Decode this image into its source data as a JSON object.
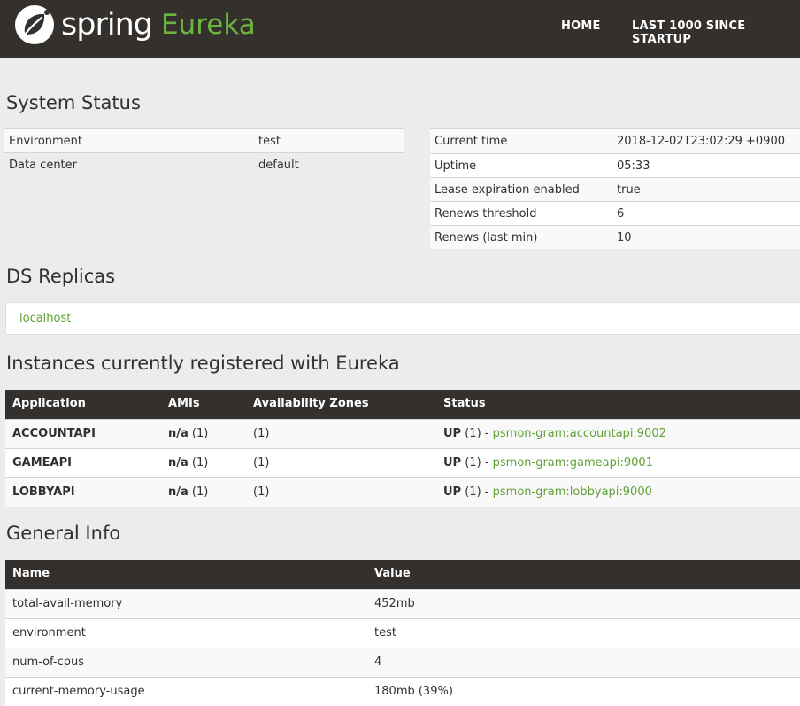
{
  "header": {
    "logo_spring": "spring",
    "logo_eureka": "Eureka",
    "nav": [
      {
        "label": "HOME"
      },
      {
        "label": "LAST 1000 SINCE STARTUP"
      }
    ]
  },
  "system_status": {
    "title": "System Status",
    "left": [
      {
        "key": "Environment",
        "value": "test"
      },
      {
        "key": "Data center",
        "value": "default"
      }
    ],
    "right": [
      {
        "key": "Current time",
        "value": "2018-12-02T23:02:29 +0900"
      },
      {
        "key": "Uptime",
        "value": "05:33"
      },
      {
        "key": "Lease expiration enabled",
        "value": "true"
      },
      {
        "key": "Renews threshold",
        "value": "6"
      },
      {
        "key": "Renews (last min)",
        "value": "10"
      }
    ]
  },
  "ds_replicas": {
    "title": "DS Replicas",
    "items": [
      "localhost"
    ]
  },
  "instances": {
    "title": "Instances currently registered with Eureka",
    "columns": [
      "Application",
      "AMIs",
      "Availability Zones",
      "Status"
    ],
    "rows": [
      {
        "app": "ACCOUNTAPI",
        "ami_na": "n/a",
        "ami_count": "(1)",
        "zones": "(1)",
        "status": "UP",
        "status_count": "(1) -",
        "link": "psmon-gram:accountapi:9002"
      },
      {
        "app": "GAMEAPI",
        "ami_na": "n/a",
        "ami_count": "(1)",
        "zones": "(1)",
        "status": "UP",
        "status_count": "(1) -",
        "link": "psmon-gram:gameapi:9001"
      },
      {
        "app": "LOBBYAPI",
        "ami_na": "n/a",
        "ami_count": "(1)",
        "zones": "(1)",
        "status": "UP",
        "status_count": "(1) -",
        "link": "psmon-gram:lobbyapi:9000"
      }
    ]
  },
  "general_info": {
    "title": "General Info",
    "columns": [
      "Name",
      "Value"
    ],
    "rows": [
      {
        "name": "total-avail-memory",
        "value": "452mb"
      },
      {
        "name": "environment",
        "value": "test"
      },
      {
        "name": "num-of-cpus",
        "value": "4"
      },
      {
        "name": "current-memory-usage",
        "value": "180mb (39%)"
      }
    ]
  },
  "colors": {
    "header_bg": "#34302d",
    "accent_green": "#6db33f",
    "link_green": "#5fa134"
  },
  "icons": {
    "logo": "spring-leaf-icon"
  }
}
